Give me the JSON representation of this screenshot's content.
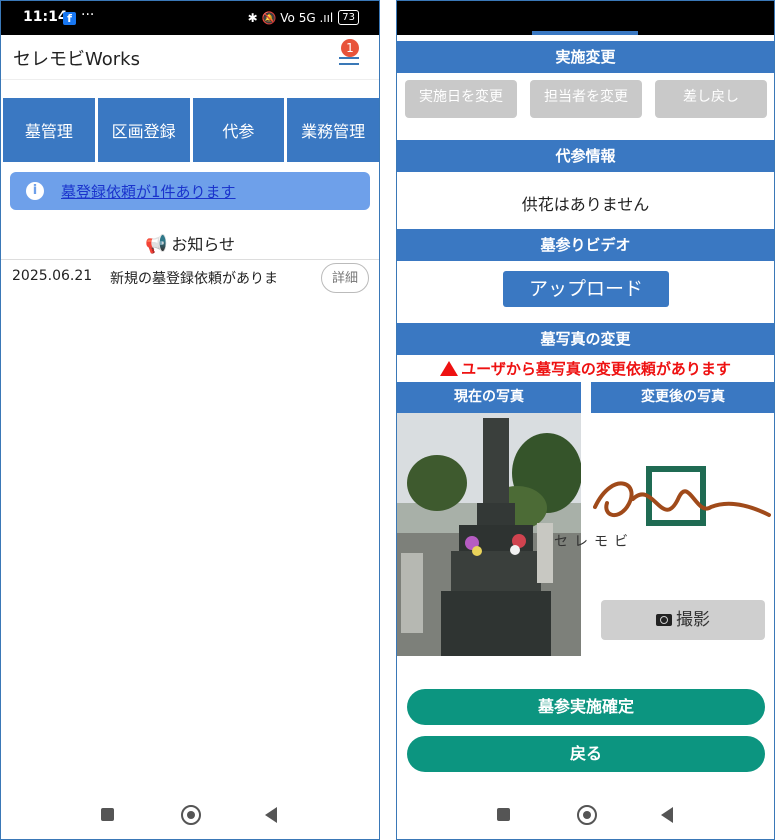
{
  "left": {
    "status": {
      "time": "11:14",
      "fb": "f",
      "dots": "···",
      "icons": "✱ 🔕 Vo 5G .ııl",
      "battery": "73"
    },
    "app": {
      "title": "セレモビWorks",
      "badge": "1"
    },
    "tiles": [
      "墓管理",
      "区画登録",
      "代参",
      "業務管理"
    ],
    "notice": {
      "icon": "i",
      "link": "墓登録依頼が1件あります"
    },
    "news": {
      "heading": "お知らせ",
      "items": [
        {
          "date": "2025.06.21",
          "text": "新規の墓登録依頼がありま",
          "button": "詳細"
        }
      ]
    }
  },
  "right": {
    "sections": {
      "jisshi_henkou": "実施変更",
      "daisan_info": "代参情報",
      "video": "墓参りビデオ",
      "photo_change": "墓写真の変更"
    },
    "buttons": {
      "change_date": "実施日を変更",
      "change_staff": "担当者を変更",
      "return": "差し戻し",
      "upload": "アップロード",
      "shoot": "撮影",
      "confirm": "墓参実施確定",
      "back": "戻る"
    },
    "kyoka": "供花はありません",
    "warning": "ユーザから墓写真の変更依頼があります",
    "columns": {
      "current": "現在の写真",
      "after": "変更後の写真"
    },
    "logo_text": "セレモビ"
  },
  "colors": {
    "primary": "#3a78c2",
    "green": "#0c9580",
    "warn": "#e11111",
    "notice_bg": "#6ea0ea"
  }
}
